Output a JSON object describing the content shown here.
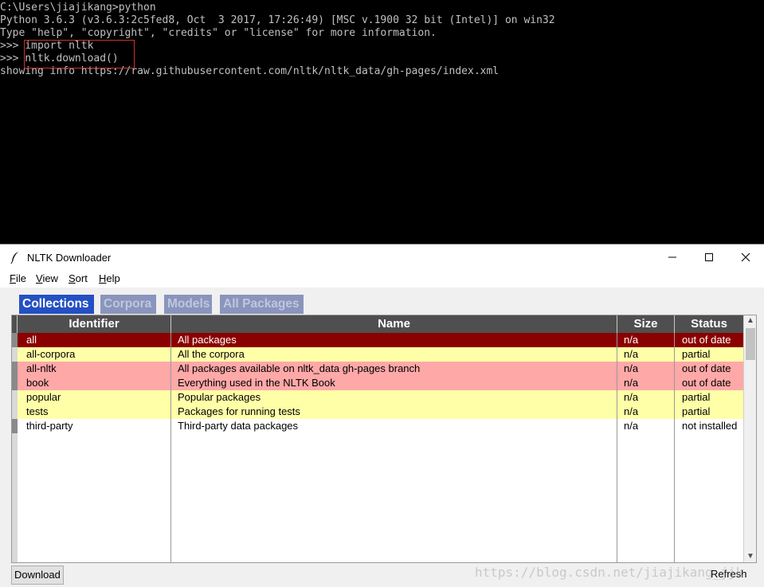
{
  "console": {
    "lines": [
      "C:\\Users\\jiajikang>python",
      "Python 3.6.3 (v3.6.3:2c5fed8, Oct  3 2017, 17:26:49) [MSC v.1900 32 bit (Intel)] on win32",
      "Type \"help\", \"copyright\", \"credits\" or \"license\" for more information.",
      ">>> import nltk",
      ">>> nltk.download()",
      "showing info https://raw.githubusercontent.com/nltk/nltk_data/gh-pages/index.xml"
    ]
  },
  "window": {
    "title": "NLTK Downloader"
  },
  "menu": [
    {
      "underline": "F",
      "rest": "ile"
    },
    {
      "underline": "V",
      "rest": "iew"
    },
    {
      "underline": "S",
      "rest": "ort"
    },
    {
      "underline": "H",
      "rest": "elp"
    }
  ],
  "tabs": [
    "Collections",
    "Corpora",
    "Models",
    "All Packages"
  ],
  "active_tab": "Collections",
  "table": {
    "columns": [
      "Identifier",
      "Name",
      "Size",
      "Status"
    ],
    "rows": [
      {
        "identifier": "all",
        "name": "All packages",
        "size": "n/a",
        "status": "out of date",
        "selected": true
      },
      {
        "identifier": "all-corpora",
        "name": "All the corpora",
        "size": "n/a",
        "status": "partial"
      },
      {
        "identifier": "all-nltk",
        "name": "All packages available on nltk_data gh-pages branch",
        "size": "n/a",
        "status": "out of date"
      },
      {
        "identifier": "book",
        "name": "Everything used in the NLTK Book",
        "size": "n/a",
        "status": "out of date"
      },
      {
        "identifier": "popular",
        "name": "Popular packages",
        "size": "n/a",
        "status": "partial"
      },
      {
        "identifier": "tests",
        "name": "Packages for running tests",
        "size": "n/a",
        "status": "partial"
      },
      {
        "identifier": "third-party",
        "name": "Third-party data packages",
        "size": "n/a",
        "status": "not installed"
      }
    ]
  },
  "status_colors": {
    "selected_bg": "#8b0000",
    "out_of_date_bg": "#ffa8a8",
    "partial_bg": "#ffffa8",
    "not_installed_bg": "#ffffff"
  },
  "buttons": {
    "download": "Download",
    "refresh": "Refresh"
  },
  "watermark": "https://blog.csdn.net/jiajikang_jjk",
  "icons": [
    "feather-icon",
    "minimize-icon",
    "maximize-icon",
    "close-icon",
    "scroll-up-icon",
    "scroll-down-icon"
  ]
}
